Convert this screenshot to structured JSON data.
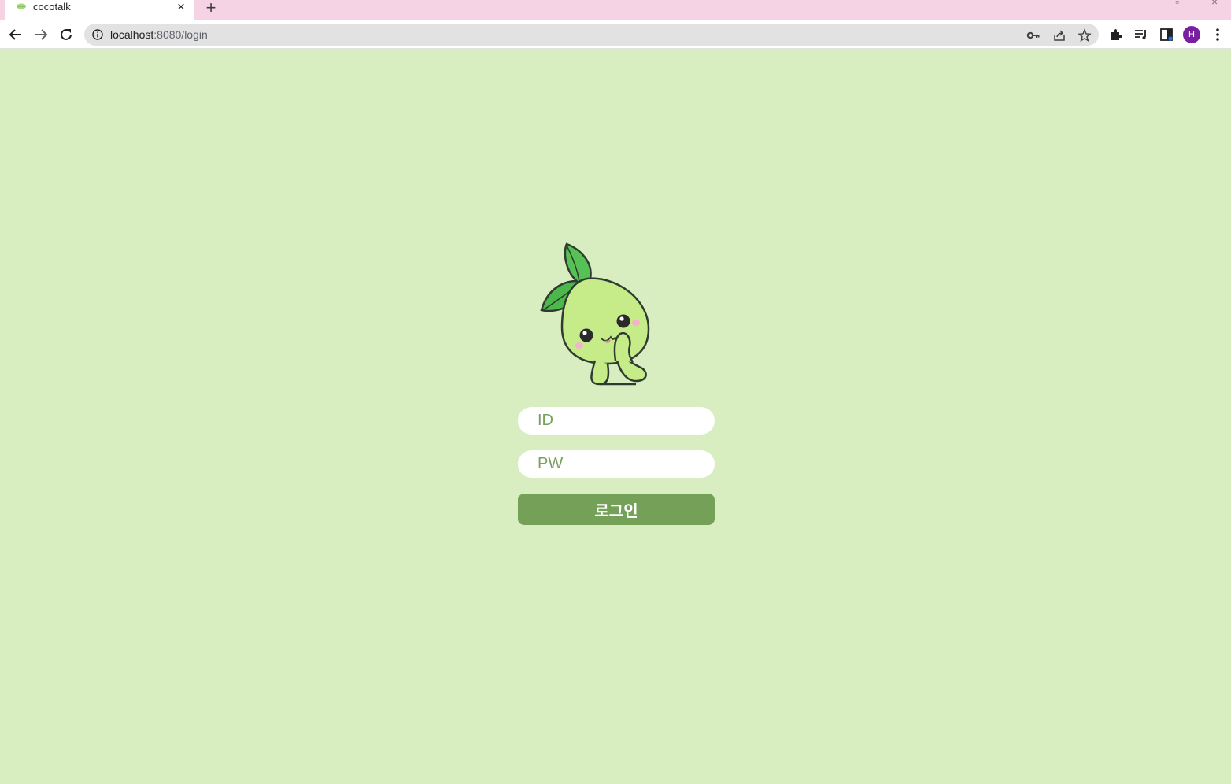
{
  "browser": {
    "tab": {
      "title": "cocotalk",
      "favicon": "leaf-icon"
    },
    "address_bar": {
      "host": "localhost",
      "path": ":8080/login"
    },
    "profile_initial": "H",
    "colors": {
      "tabstrip": "#f6d3e4",
      "avatar": "#7b1fa2"
    }
  },
  "login": {
    "id_placeholder": "ID",
    "pw_placeholder": "PW",
    "submit_label": "로그인",
    "mascot": "sprout-mascot",
    "colors": {
      "background": "#d8eec0",
      "button": "#74a058",
      "placeholder": "#78a05e"
    }
  }
}
